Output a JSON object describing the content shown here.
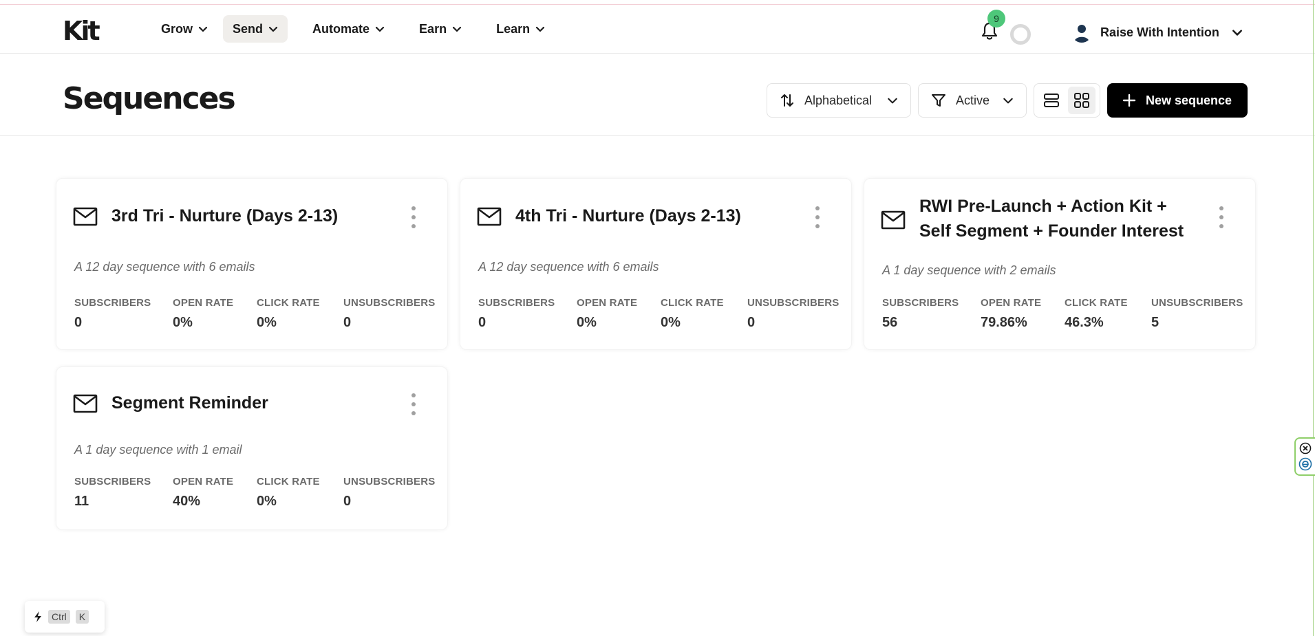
{
  "header": {
    "logo": "Kit",
    "nav": [
      {
        "label": "Grow"
      },
      {
        "label": "Send"
      },
      {
        "label": "Automate"
      },
      {
        "label": "Earn"
      },
      {
        "label": "Learn"
      }
    ],
    "active_nav": "Send",
    "notification_count": "9",
    "account_name": "Raise With Intention"
  },
  "page": {
    "title": "Sequences",
    "sort_label": "Alphabetical",
    "filter_label": "Active",
    "new_button_label": "New sequence"
  },
  "stat_labels": {
    "subscribers": "SUBSCRIBERS",
    "open_rate": "OPEN RATE",
    "click_rate": "CLICK RATE",
    "unsubscribers": "UNSUBSCRIBERS"
  },
  "sequences": [
    {
      "title": "3rd Tri - Nurture (Days 2-13)",
      "description": "A 12 day sequence with 6 emails",
      "subscribers": "0",
      "open_rate": "0%",
      "click_rate": "0%",
      "unsubscribers": "0"
    },
    {
      "title": "4th Tri - Nurture (Days 2-13)",
      "description": "A 12 day sequence with 6 emails",
      "subscribers": "0",
      "open_rate": "0%",
      "click_rate": "0%",
      "unsubscribers": "0"
    },
    {
      "title_line1": "RWI Pre-Launch + Action Kit +",
      "title_line2": "Self Segment + Founder Interest",
      "description": "A 1 day sequence with 2 emails",
      "subscribers": "56",
      "open_rate": "79.86%",
      "click_rate": "46.3%",
      "unsubscribers": "5"
    },
    {
      "title": "Segment Reminder",
      "description": "A 1 day sequence with 1 email",
      "subscribers": "11",
      "open_rate": "40%",
      "click_rate": "0%",
      "unsubscribers": "0"
    }
  ],
  "command_bar": {
    "key1": "Ctrl",
    "key2": "K"
  },
  "colors": {
    "badge": "#4ec77a",
    "primary_button": "#000000",
    "active_nav_bg": "#f0eeeb"
  }
}
